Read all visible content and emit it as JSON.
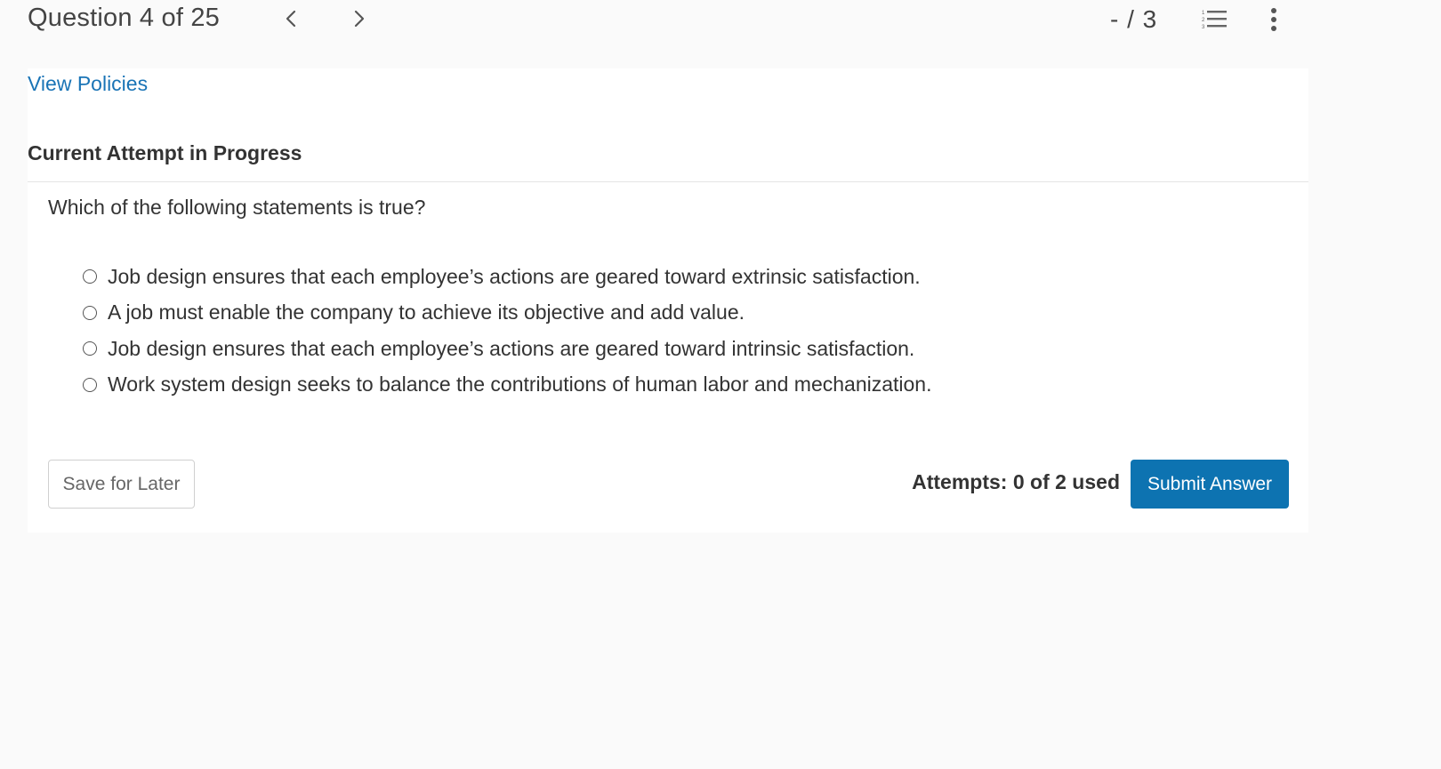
{
  "header": {
    "question_label": "Question 4 of 25",
    "prev_icon": "chevron-left-icon",
    "next_icon": "chevron-right-icon",
    "score": "- / 3",
    "list_icon": "numbered-list-icon",
    "more_icon": "vertical-ellipsis-icon"
  },
  "panel": {
    "policies_link": "View Policies",
    "attempt_heading": "Current Attempt in Progress",
    "question": "Which of the following statements is true?",
    "options": [
      {
        "label": "Job design ensures that each employee’s actions are geared toward extrinsic satisfaction."
      },
      {
        "label": "A job must enable the company to achieve its objective and add value."
      },
      {
        "label": "Job design ensures that each employee’s actions are geared toward intrinsic satisfaction."
      },
      {
        "label": "Work system design seeks to balance the contributions of human labor and mechanization."
      }
    ],
    "save_label": "Save for Later",
    "attempts": "Attempts: 0 of 2 used",
    "submit_label": "Submit Answer"
  },
  "colors": {
    "link": "#1a74b6",
    "primary_button": "#0d73b1",
    "background": "#fafafa"
  }
}
